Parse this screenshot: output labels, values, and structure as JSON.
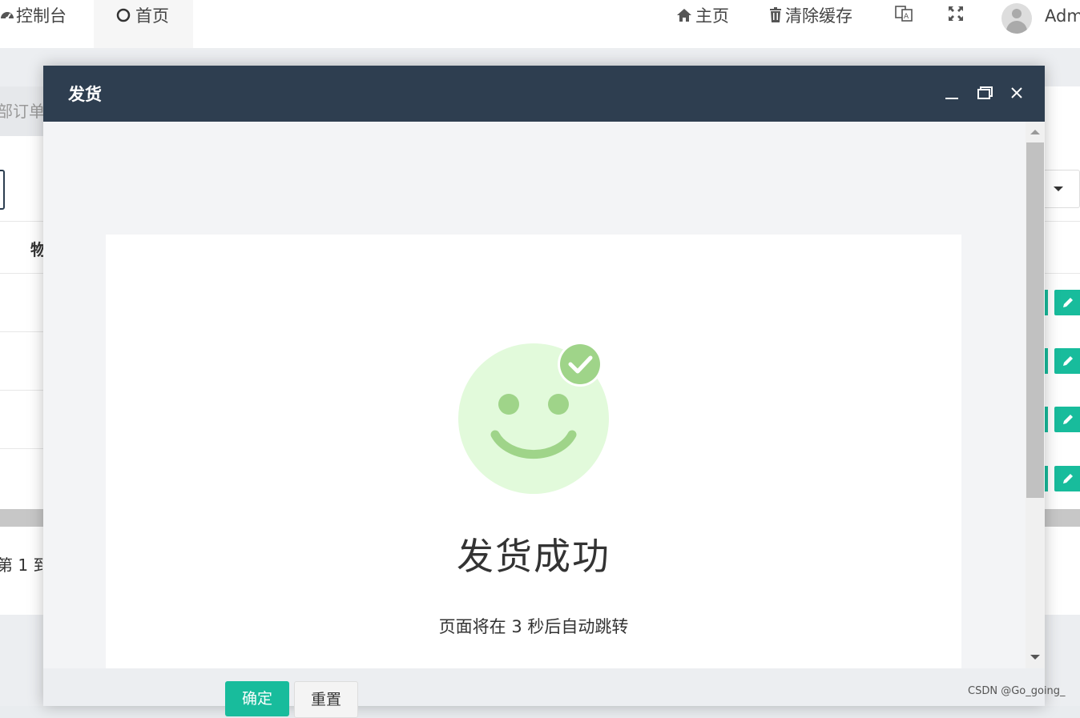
{
  "topbar": {
    "tabs": [
      {
        "label": "控制台"
      },
      {
        "label": "首页"
      }
    ],
    "right": {
      "home_label": "主页",
      "clear_cache_label": "清除缓存",
      "user_label": "Adm"
    }
  },
  "background": {
    "breadcrumb_partial": "部订单",
    "column_partial": "物",
    "pagination_partial": "第 1 到"
  },
  "modal": {
    "title": "发货",
    "success_title": "发货成功",
    "redirect_message": "页面将在 3 秒后自动跳转",
    "ok_label": "确定",
    "reset_label": "重置"
  },
  "colors": {
    "header_bg": "#2e3e50",
    "accent": "#18bc9c",
    "smiley_face": "#e2fadb",
    "smiley_features": "#9fd489"
  },
  "icons": [
    "dashboard-icon",
    "circle-icon",
    "home-icon",
    "trash-icon",
    "translate-icon",
    "fullscreen-icon",
    "minimize-icon",
    "maximize-icon",
    "close-icon",
    "check-icon",
    "pencil-icon"
  ],
  "watermark": "CSDN @Go_going_"
}
